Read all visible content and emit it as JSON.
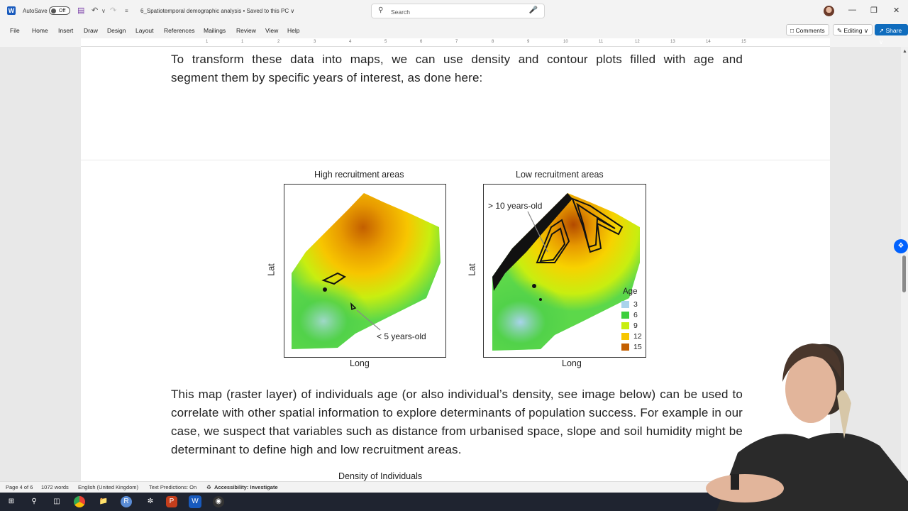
{
  "titlebar": {
    "autosave_label": "AutoSave",
    "autosave_state": "Off",
    "doc_title": "6_Spatiotemporal demographic analysis • Saved to this PC ∨",
    "search_placeholder": "Search",
    "icons": [
      "word-icon",
      "save-icon",
      "undo-icon",
      "redo-icon",
      "customize-icon",
      "search-icon",
      "mic-icon",
      "minimize-icon",
      "restore-icon",
      "close-icon"
    ]
  },
  "ribbon": {
    "tabs": [
      "File",
      "Home",
      "Insert",
      "Draw",
      "Design",
      "Layout",
      "References",
      "Mailings",
      "Review",
      "View",
      "Help"
    ],
    "comments_label": "Comments",
    "editing_label": "Editing ∨",
    "share_label": "Share ∨"
  },
  "ruler": {
    "numbers": [
      "1",
      "1",
      "2",
      "3",
      "4",
      "5",
      "6",
      "7",
      "8",
      "9",
      "10",
      "11",
      "12",
      "13",
      "14",
      "15"
    ]
  },
  "document": {
    "para1_line1": "To transform these data into maps, we can use density and contour plots filled with age and",
    "para1_line2": "segment them by specific years of interest, as done here:",
    "para2": "This map (raster layer) of individuals age (or also individual’s density, see image below) can be used to correlate with other spatial information to explore determinants of population success. For example in our case, we suspect that variables such as distance from urbanised space, slope and soil humidity might be determinant to define high and low recruitment areas.",
    "density_title": "Density of Individuals"
  },
  "figure": {
    "left_title": "High recruitment areas",
    "right_title": "Low recruitment areas",
    "y_label": "Lat",
    "x_label": "Long",
    "left_annotation": "< 5 years-old",
    "right_annotation": "> 10 years-old",
    "legend_title": "Age",
    "legend": [
      {
        "label": "3",
        "color": "#a9d3ec"
      },
      {
        "label": "6",
        "color": "#3ccf3c"
      },
      {
        "label": "9",
        "color": "#c8ee10"
      },
      {
        "label": "12",
        "color": "#f7c600"
      },
      {
        "label": "15",
        "color": "#c35f00"
      }
    ]
  },
  "statusbar": {
    "page": "Page 4 of 6",
    "words": "1072 words",
    "language": "English (United Kingdom)",
    "predictions": "Text Predictions: On",
    "accessibility": "Accessibility: Investigate"
  },
  "taskbar": {
    "apps": [
      "windows-start-icon",
      "search-icon",
      "task-view-icon",
      "chrome-icon",
      "file-explorer-icon",
      "r-icon",
      "davinci-icon",
      "powerpoint-icon",
      "word-icon",
      "obs-icon"
    ]
  }
}
